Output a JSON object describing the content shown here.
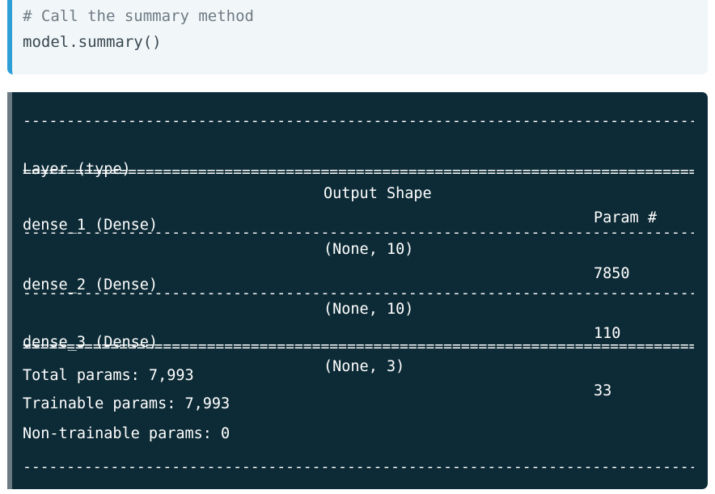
{
  "code": {
    "lines": [
      "# Call the summary method",
      "model.summary()"
    ]
  },
  "output": {
    "header": {
      "layer": "Layer (type)",
      "shape": "Output Shape",
      "params": "Param #"
    },
    "dash_line": "----------------------------------------------------------------------------------------------------",
    "eq_line": "====================================================================================================",
    "rows": [
      {
        "layer": "dense_1 (Dense)",
        "shape": "(None, 10)",
        "params": "7850"
      },
      {
        "layer": "dense_2 (Dense)",
        "shape": "(None, 10)",
        "params": "110"
      },
      {
        "layer": "dense_3 (Dense)",
        "shape": "(None, 3)",
        "params": "33"
      }
    ],
    "totals": {
      "total": "Total params: 7,993",
      "trainable": "Trainable params: 7,993",
      "non_trainable": "Non-trainable params: 0"
    }
  }
}
